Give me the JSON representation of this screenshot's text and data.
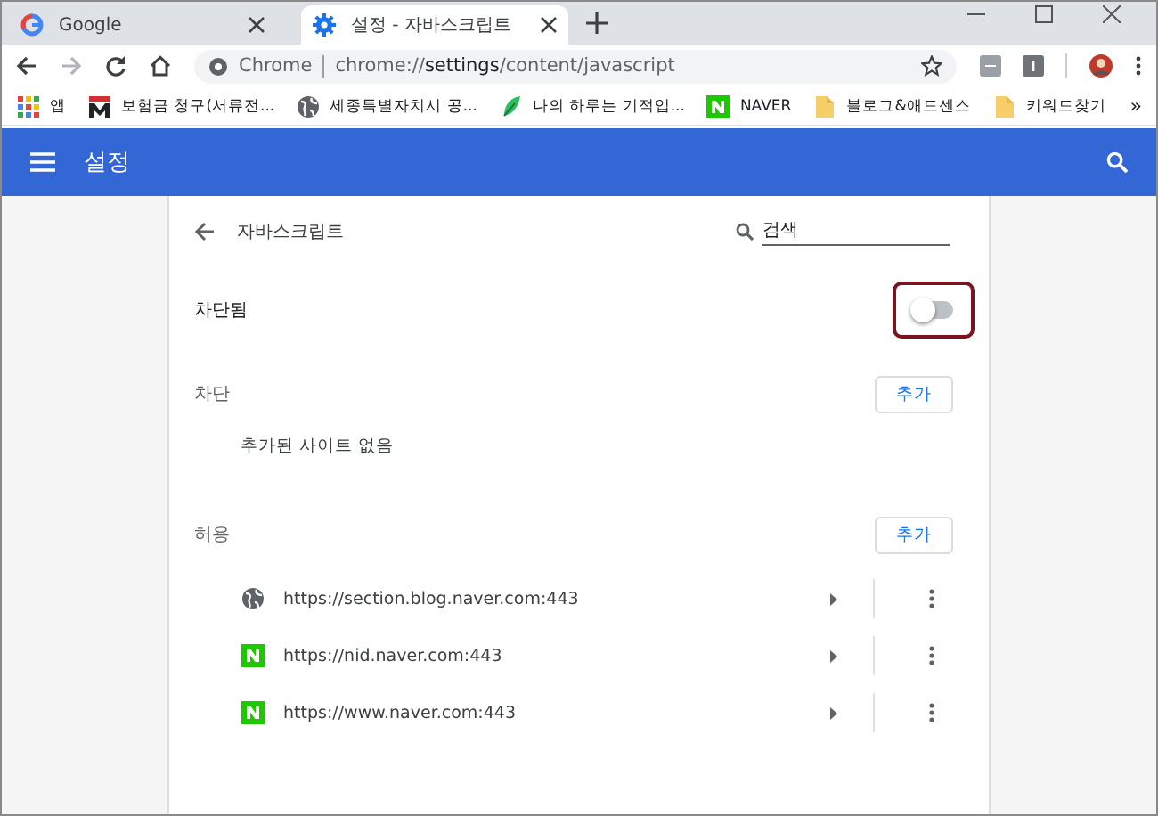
{
  "tabs": [
    {
      "title": "Google",
      "kind": "google",
      "selected": false
    },
    {
      "title": "설정 - 자바스크립트",
      "kind": "gear",
      "selected": true
    }
  ],
  "toolbar": {
    "chip": "Chrome",
    "url": "chrome://**settings**/content/javascript"
  },
  "bookmarks": [
    {
      "label": "앱",
      "kind": "apps"
    },
    {
      "label": "보험금 청구(서류전...",
      "kind": "m"
    },
    {
      "label": "세종특별자치시 공...",
      "kind": "globe"
    },
    {
      "label": "나의 하루는 기적입...",
      "kind": "leaf"
    },
    {
      "label": "NAVER",
      "kind": "naver"
    },
    {
      "label": "블로그&애드센스",
      "kind": "folder"
    },
    {
      "label": "키워드찾기",
      "kind": "folder"
    }
  ],
  "bookmarks_more": "»",
  "header": {
    "title": "설정"
  },
  "page": {
    "title": "자바스크립트",
    "search_placeholder": "검색"
  },
  "setting": {
    "label": "차단됨",
    "on": false,
    "highlighted": true
  },
  "sections": [
    {
      "title": "차단",
      "button": "추가",
      "empty": "추가된 사이트 없음"
    },
    {
      "title": "허용",
      "button": "추가",
      "sites": [
        {
          "url": "https://section.blog.naver.com:443",
          "kind": "globe"
        },
        {
          "url": "https://nid.naver.com:443",
          "kind": "naver"
        },
        {
          "url": "https://www.naver.com:443",
          "kind": "naver"
        }
      ]
    }
  ]
}
